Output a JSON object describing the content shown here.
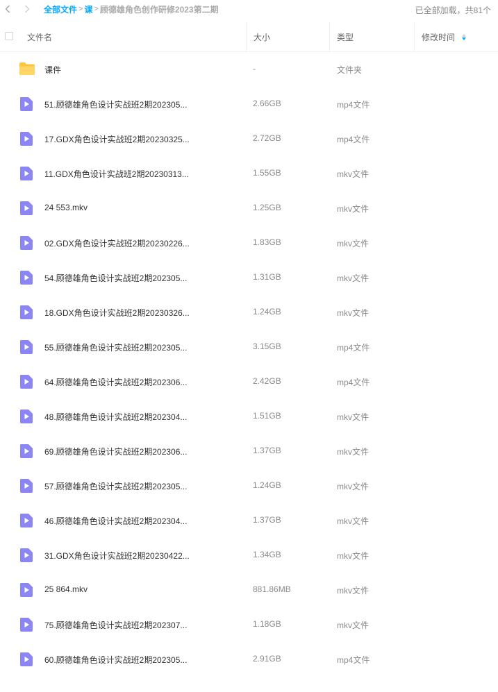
{
  "breadcrumb": {
    "root": "全部文件",
    "level1": "课",
    "current": "顾德雄角色创作研修2023第二期"
  },
  "status": "已全部加载，共81个",
  "columns": {
    "name": "文件名",
    "size": "大小",
    "type": "类型",
    "modified": "修改时间"
  },
  "colors": {
    "accent": "#06a7ff",
    "video_icon": "#8b86f3",
    "folder_icon": "#ffc53d"
  },
  "files": [
    {
      "icon": "folder-icon",
      "name": "课件",
      "size": "-",
      "type": "文件夹"
    },
    {
      "icon": "video-file-icon",
      "name": "51.顾德雄角色设计实战班2期202305...",
      "size": "2.66GB",
      "type": "mp4文件"
    },
    {
      "icon": "video-file-icon",
      "name": "17.GDX角色设计实战班2期20230325...",
      "size": "2.72GB",
      "type": "mp4文件"
    },
    {
      "icon": "video-file-icon",
      "name": "11.GDX角色设计实战班2期20230313...",
      "size": "1.55GB",
      "type": "mkv文件"
    },
    {
      "icon": "video-file-icon",
      "name": "24 553.mkv",
      "size": "1.25GB",
      "type": "mkv文件"
    },
    {
      "icon": "video-file-icon",
      "name": "02.GDX角色设计实战班2期20230226...",
      "size": "1.83GB",
      "type": "mkv文件"
    },
    {
      "icon": "video-file-icon",
      "name": "54.顾德雄角色设计实战班2期202305...",
      "size": "1.31GB",
      "type": "mkv文件"
    },
    {
      "icon": "video-file-icon",
      "name": "18.GDX角色设计实战班2期20230326...",
      "size": "1.24GB",
      "type": "mkv文件"
    },
    {
      "icon": "video-file-icon",
      "name": "55.顾德雄角色设计实战班2期202305...",
      "size": "3.15GB",
      "type": "mp4文件"
    },
    {
      "icon": "video-file-icon",
      "name": "64.顾德雄角色设计实战班2期202306...",
      "size": "2.42GB",
      "type": "mp4文件"
    },
    {
      "icon": "video-file-icon",
      "name": "48.顾德雄角色设计实战班2期202304...",
      "size": "1.51GB",
      "type": "mkv文件"
    },
    {
      "icon": "video-file-icon",
      "name": "69.顾德雄角色设计实战班2期202306...",
      "size": "1.37GB",
      "type": "mkv文件"
    },
    {
      "icon": "video-file-icon",
      "name": "57.顾德雄角色设计实战班2期202305...",
      "size": "1.24GB",
      "type": "mkv文件"
    },
    {
      "icon": "video-file-icon",
      "name": "46.顾德雄角色设计实战班2期202304...",
      "size": "1.37GB",
      "type": "mkv文件"
    },
    {
      "icon": "video-file-icon",
      "name": "31.GDX角色设计实战班2期20230422...",
      "size": "1.34GB",
      "type": "mkv文件"
    },
    {
      "icon": "video-file-icon",
      "name": "25 864.mkv",
      "size": "881.86MB",
      "type": "mkv文件"
    },
    {
      "icon": "video-file-icon",
      "name": "75.顾德雄角色设计实战班2期202307...",
      "size": "1.18GB",
      "type": "mkv文件"
    },
    {
      "icon": "video-file-icon",
      "name": "60.顾德雄角色设计实战班2期202305...",
      "size": "2.91GB",
      "type": "mp4文件"
    }
  ]
}
